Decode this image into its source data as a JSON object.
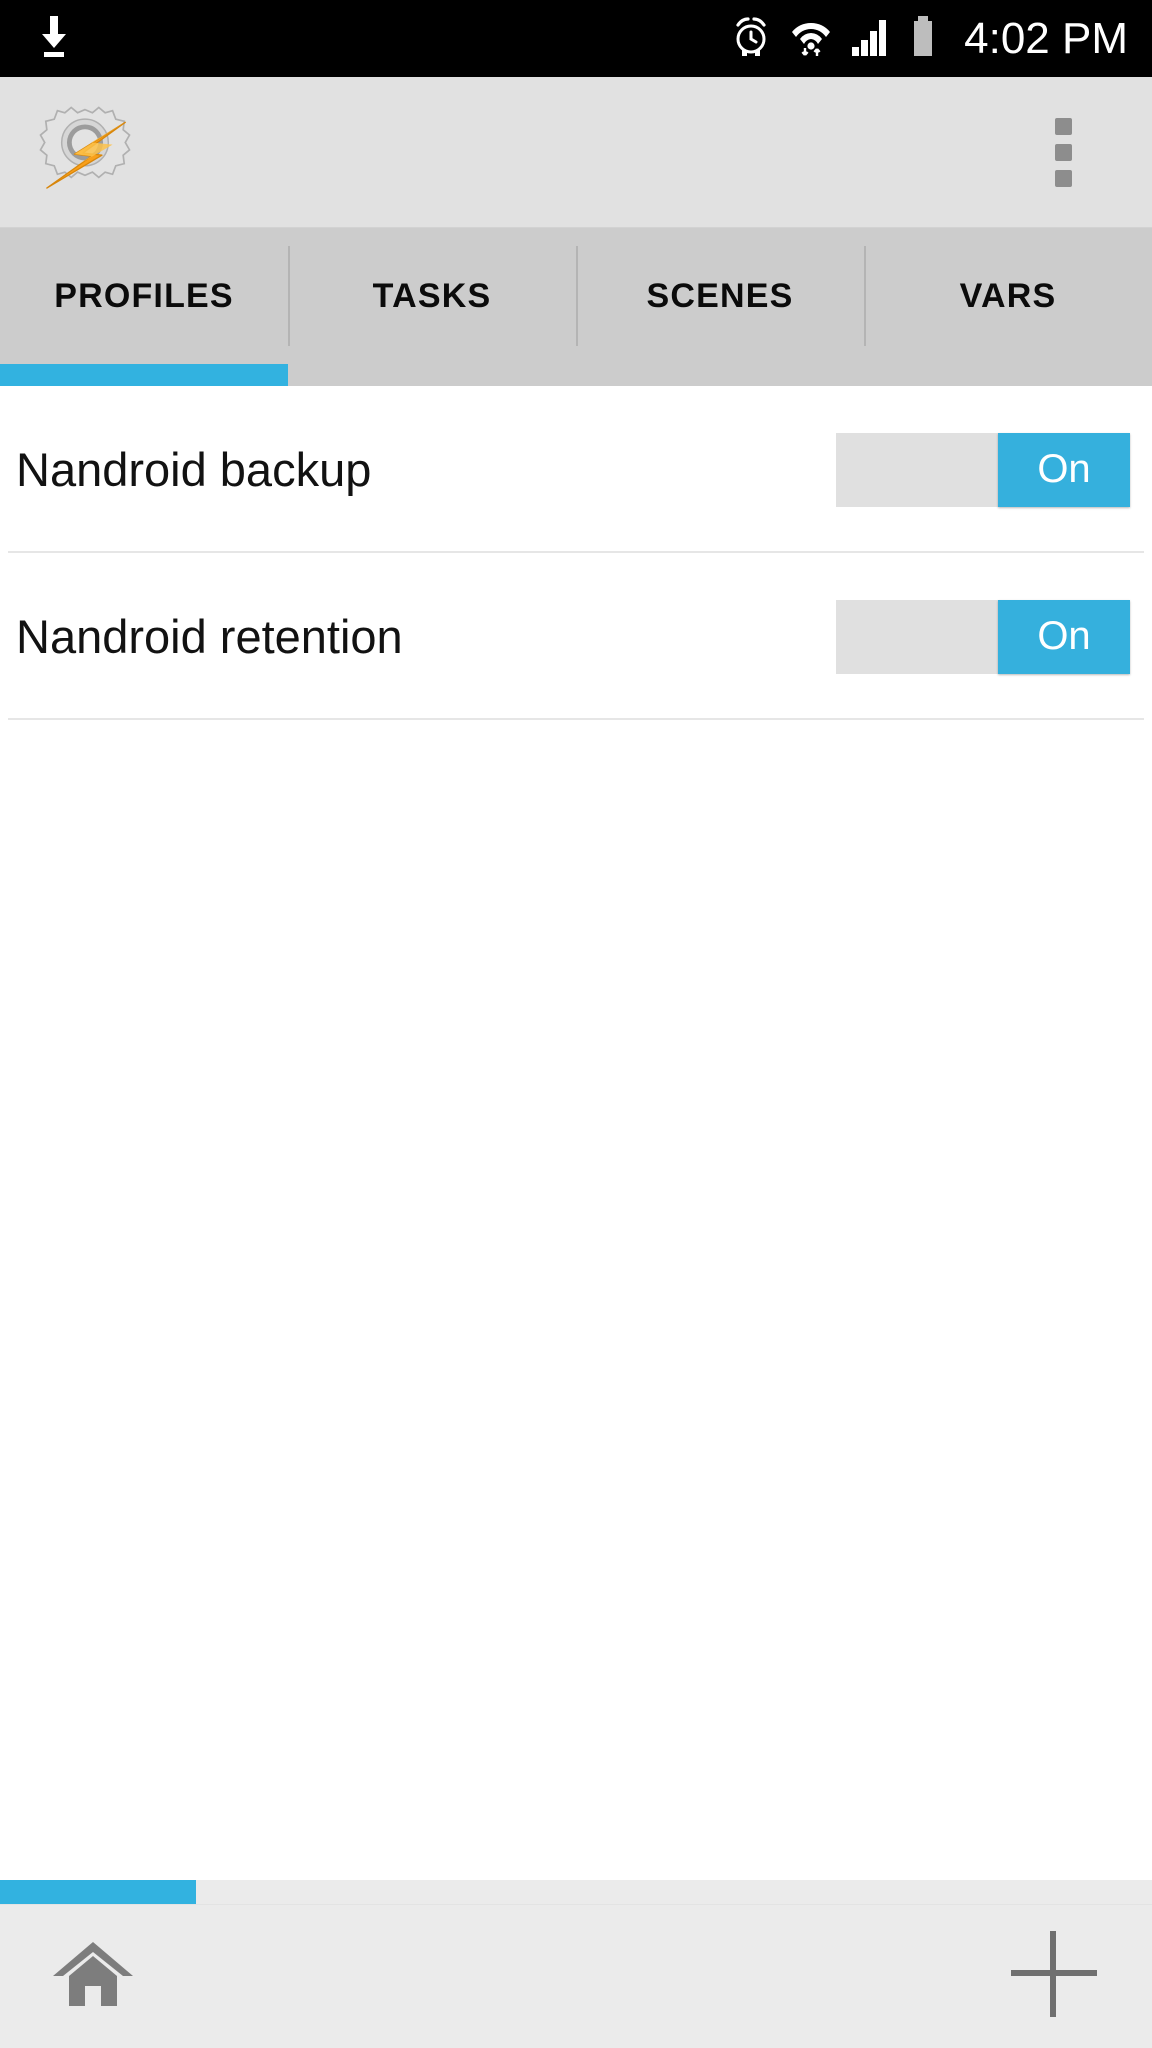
{
  "status_bar": {
    "background": "#000000",
    "time": "4:02 PM",
    "left_icons": [
      {
        "name": "download-icon",
        "label": "Download"
      }
    ],
    "right_icons": [
      {
        "name": "alarm-icon",
        "label": "Alarm set"
      },
      {
        "name": "wifi-icon",
        "label": "Wi-Fi connected"
      },
      {
        "name": "signal-icon",
        "label": "Cellular signal"
      },
      {
        "name": "battery-icon",
        "label": "Battery"
      }
    ]
  },
  "app_header": {
    "background": "#e1e1e1",
    "logo_name": "tasker-logo",
    "logo_alt": "Tasker",
    "overflow_label": "More options"
  },
  "tabs": {
    "active_index": 0,
    "indicator_color": "#32b2e0",
    "items": [
      {
        "label": "PROFILES"
      },
      {
        "label": "TASKS"
      },
      {
        "label": "SCENES"
      },
      {
        "label": "VARS"
      }
    ]
  },
  "profiles": {
    "rows": [
      {
        "label": "Nandroid backup",
        "toggle_state": "On"
      },
      {
        "label": "Nandroid retention",
        "toggle_state": "On"
      }
    ]
  },
  "bottom_bar": {
    "background": "#ebebeb",
    "progress_color": "#32b2e0",
    "progress_percent": 17,
    "home_label": "Home",
    "add_label": "Add"
  },
  "colors": {
    "accent": "#32b2e0",
    "toggle_on": "#35b0dd",
    "tab_bar": "#cccccc",
    "header": "#e1e1e1",
    "text": "#121212"
  }
}
